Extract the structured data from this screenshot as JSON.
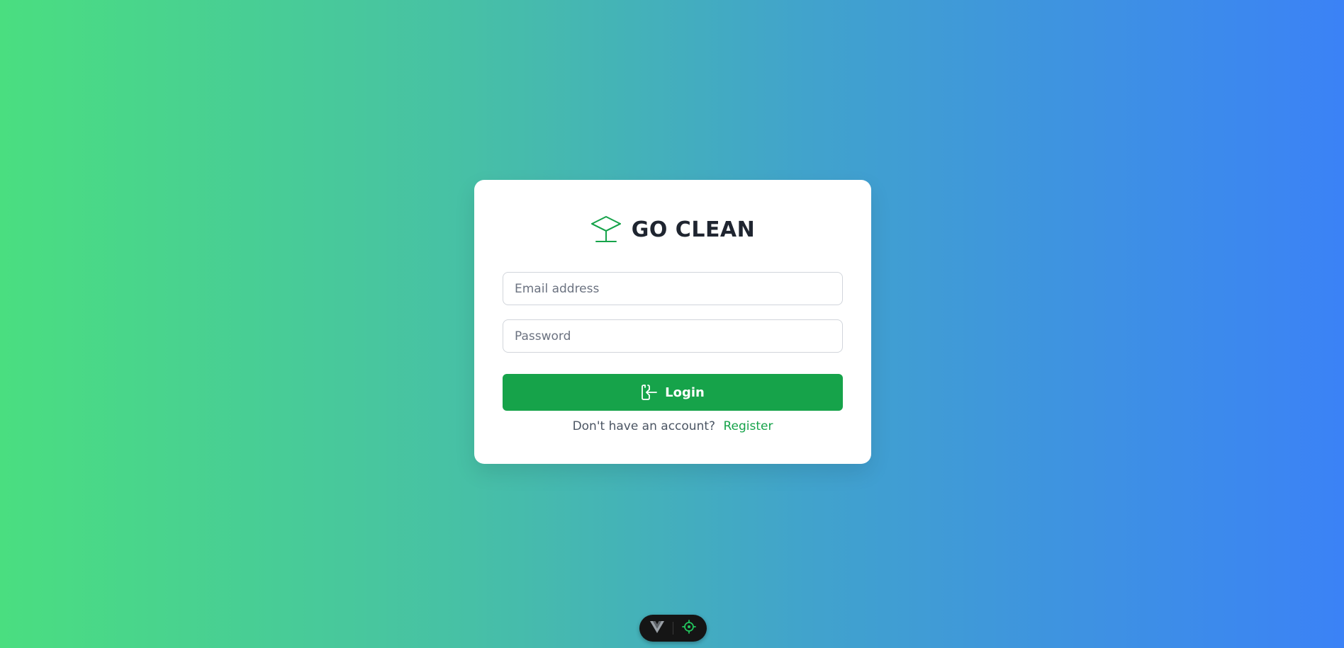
{
  "brand": {
    "title": "GO CLEAN",
    "icon": "lamp-icon",
    "color": "#16a34a"
  },
  "form": {
    "email_placeholder": "Email address",
    "email_value": "",
    "password_placeholder": "Password",
    "password_value": "",
    "login_label": "Login",
    "login_icon": "login-door-icon"
  },
  "register": {
    "prompt": "Don't have an account?",
    "link_label": "Register"
  },
  "devtools": {
    "vue_icon": "vue-logo-icon",
    "inspect_icon": "crosshair-icon"
  },
  "colors": {
    "accent": "#16a34a",
    "gradient_start": "#4ade80",
    "gradient_end": "#3b82f6"
  }
}
